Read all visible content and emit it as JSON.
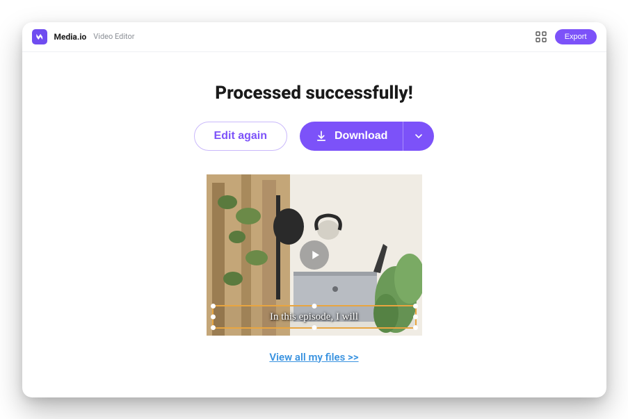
{
  "header": {
    "brand": "Media.io",
    "subtitle": "Video Editor",
    "export_label": "Export"
  },
  "main": {
    "title": "Processed successfully!",
    "edit_again_label": "Edit again",
    "download_label": "Download",
    "caption_text": "In this episode, I will",
    "view_files_link": "View all my files >>"
  },
  "colors": {
    "primary": "#7c52f9",
    "link": "#3a93e0"
  }
}
